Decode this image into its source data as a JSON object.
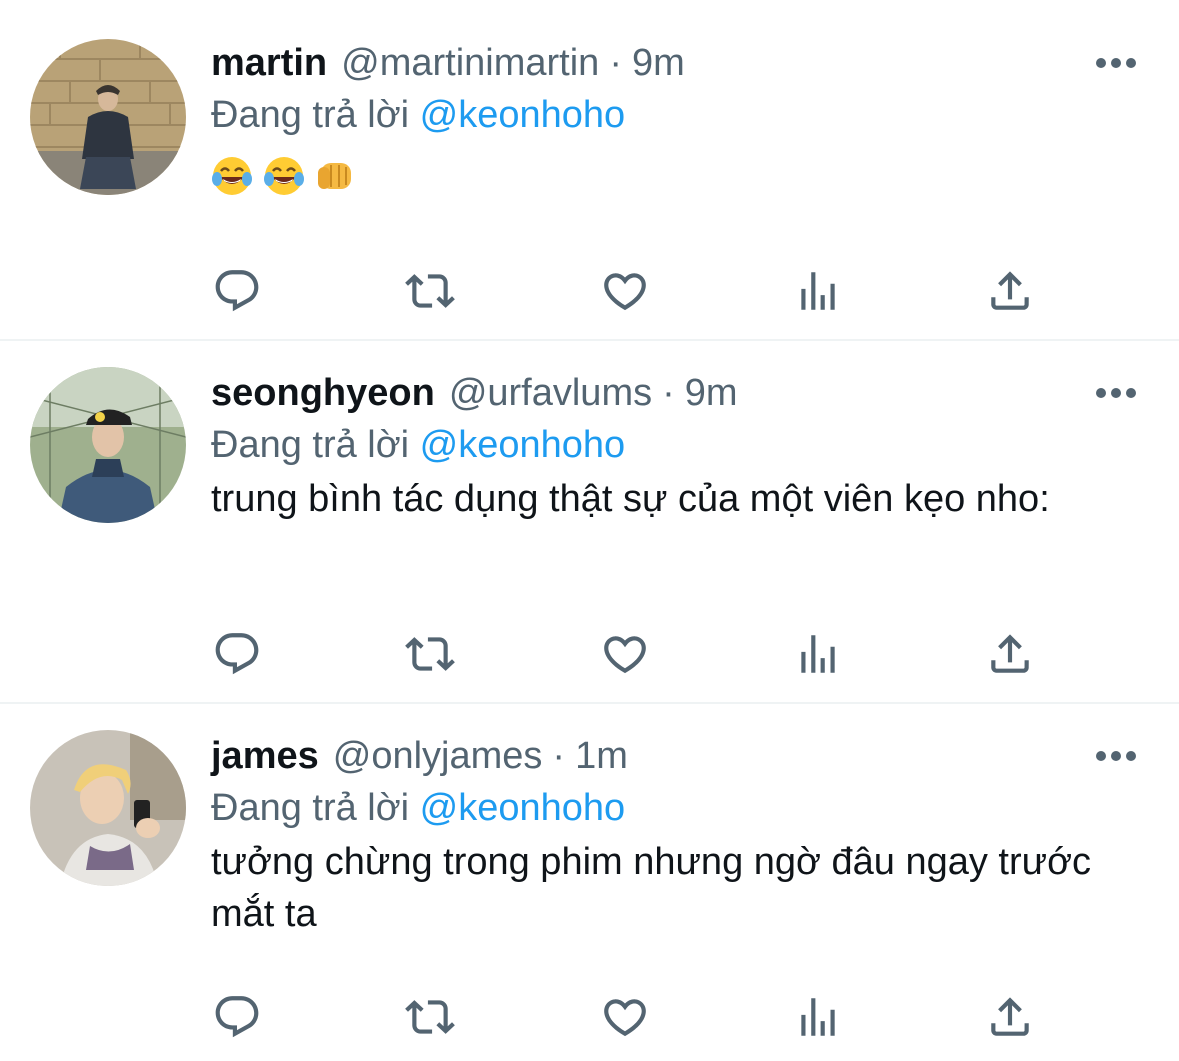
{
  "tweets": [
    {
      "name": "martin",
      "handle": "@martinimartin",
      "separator": "·",
      "time": "9m",
      "reply_prefix": "Đang trả lời",
      "reply_to": "@keonhoho",
      "text": "",
      "emojis": [
        "face-with-tears-of-joy",
        "face-with-tears-of-joy",
        "oncoming-fist"
      ]
    },
    {
      "name": "seonghyeon",
      "handle": "@urfavlums",
      "separator": "·",
      "time": "9m",
      "reply_prefix": "Đang trả lời",
      "reply_to": "@keonhoho",
      "text": "trung bình tác dụng thật sự của một viên kẹo nho:",
      "emojis": []
    },
    {
      "name": "james",
      "handle": "@onlyjames",
      "separator": "·",
      "time": "1m",
      "reply_prefix": "Đang trả lời",
      "reply_to": "@keonhoho",
      "text": "tưởng chừng trong phim nhưng ngờ đâu ngay trước mắt ta",
      "emojis": []
    }
  ],
  "actions": [
    "reply-icon",
    "retweet-icon",
    "like-icon",
    "views-icon",
    "share-icon"
  ],
  "colors": {
    "text": "#0f1419",
    "secondary": "#536471",
    "mention": "#1d9bf0",
    "divider": "#eff3f4"
  }
}
